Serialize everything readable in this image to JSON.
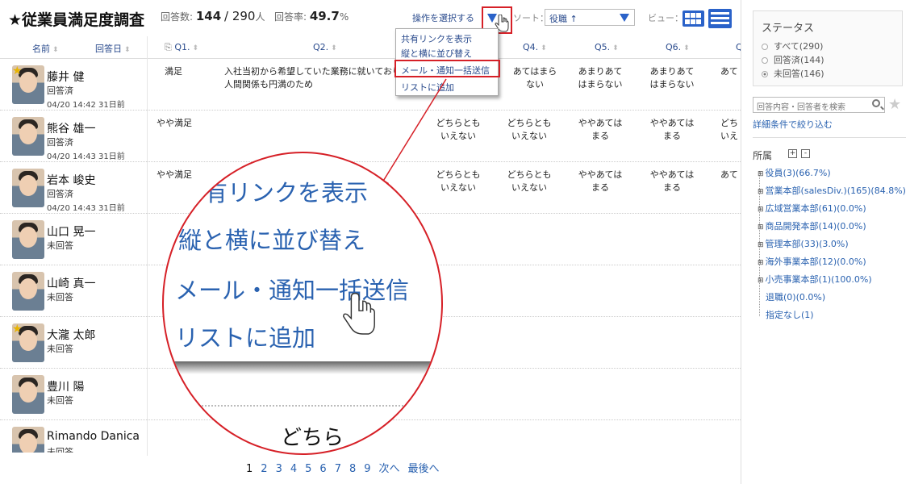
{
  "header": {
    "title": "★従業員満足度調査",
    "responses_label": "回答数:",
    "responses_count": "144",
    "responses_total": "/ 290",
    "responses_unit": "人",
    "rate_label": "回答率:",
    "rate_value": "49.7",
    "rate_unit": "%"
  },
  "toolbar": {
    "action_select_label": "操作を選択する",
    "sort_label": "ソート：",
    "sort_value": "役職 ↑",
    "view_label": "ビュー："
  },
  "dropdown": {
    "items": [
      "共有リンクを表示",
      "縦と横に並び替え",
      "メール・通知一括送信",
      "リストに追加"
    ]
  },
  "table": {
    "columns": [
      "名前",
      "回答日",
      "Q1.",
      "Q2.",
      "Q4.",
      "Q5.",
      "Q6.",
      "Q"
    ],
    "rows": [
      {
        "name": "藤井 健",
        "status": "回答済",
        "date": "04/20 14:42 31日前",
        "q1": "満足",
        "q2_line1": "入社当初から希望していた業務に就いており",
        "q2_line2": "人間関係も円満のため",
        "q3_line1": "",
        "q3_line2": "",
        "q4_line1": "あてはまら",
        "q4_line2": "ない",
        "q5_line1": "あまりあて",
        "q5_line2": "はまらない",
        "q6_line1": "あまりあて",
        "q6_line2": "はまらない",
        "q7": "あて"
      },
      {
        "name": "熊谷 雄一",
        "status": "回答済",
        "date": "04/20 14:43 31日前",
        "q1": "やや満足",
        "q2_line1": "",
        "q2_line2": "",
        "q3_line1": "どちらとも",
        "q3_line2": "いえない",
        "q4_line1": "どちらとも",
        "q4_line2": "いえない",
        "q5_line1": "ややあては",
        "q5_line2": "まる",
        "q6_line1": "ややあては",
        "q6_line2": "まる",
        "q7": "どち",
        "q7b": "いえ"
      },
      {
        "name": "岩本 峻史",
        "status": "回答済",
        "date": "04/20 14:43 31日前",
        "q1": "やや満足",
        "q2_line1": "",
        "q2_line2": "",
        "q3_line1": "どちらとも",
        "q3_line2": "いえない",
        "q4_line1": "どちらとも",
        "q4_line2": "いえない",
        "q5_line1": "ややあては",
        "q5_line2": "まる",
        "q6_line1": "ややあては",
        "q6_line2": "まる",
        "q7": "あて"
      },
      {
        "name": "山口 晃一",
        "status": "未回答"
      },
      {
        "name": "山崎 真一",
        "status": "未回答"
      },
      {
        "name": "大瀧 太郎",
        "status": "未回答"
      },
      {
        "name": "豊川 陽",
        "status": "未回答"
      },
      {
        "name": "Rimando Danica",
        "status": "未回答"
      }
    ]
  },
  "magnifier": {
    "lines": [
      "有リンクを表示",
      "縦と横に並び替え",
      "メール・通知一括送信",
      "リストに追加"
    ],
    "bottom_text": "どちら"
  },
  "pagination": {
    "pages": [
      "1",
      "2",
      "3",
      "4",
      "5",
      "6",
      "7",
      "8",
      "9"
    ],
    "next": "次へ",
    "last": "最後へ"
  },
  "sidebar": {
    "status_title": "ステータス",
    "status_options": [
      "すべて(290)",
      "回答済(144)",
      "未回答(146)"
    ],
    "search_placeholder": "回答内容・回答者を検索",
    "filter_link": "詳細条件で絞り込む",
    "org_title": "所属",
    "org_items": [
      "役員(3)(66.7%)",
      "営業本部(salesDiv.)(165)(84.8%)",
      "広域営業本部(61)(0.0%)",
      "商品開発本部(14)(0.0%)",
      "管理本部(33)(3.0%)",
      "海外事業本部(12)(0.0%)",
      "小売事業本部(1)(100.0%)",
      "退職(0)(0.0%)",
      "指定なし(1)"
    ]
  },
  "colors": {
    "accent": "#2a62c9",
    "link": "#2a62b0",
    "highlight": "#d62027"
  }
}
